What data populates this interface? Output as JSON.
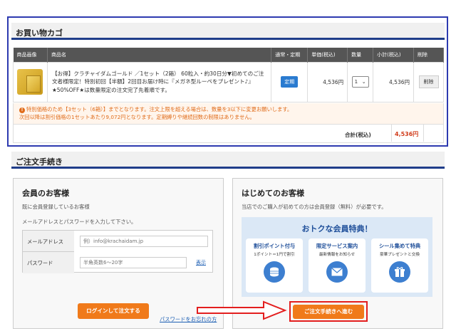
{
  "cart": {
    "section_title": "お買い物カゴ",
    "columns": [
      "商品画像",
      "商品名",
      "通常・定期",
      "単価(税込)",
      "数量",
      "小計(税込)",
      "削除"
    ],
    "item": {
      "name": "【お得】クラチャイダムゴールド ／1セット（2箱） 60粒入・約30日分▼初めてのご注文者様限定！特別初回【半額】2回目お届け時に『メガネ型ルーペをプレゼント♪』★50%OFF★は数量限定の注文完了先着順です。",
      "type_badge": "定期",
      "unit_price": "4,536円",
      "quantity": "1",
      "subtotal": "4,536円",
      "delete_label": "削除"
    },
    "notice_line1": "特別価格のため【3セット（6箱）】までとなります。注文上限を超える場合は、数量を3以下に変更お願いします。",
    "notice_line2": "次回以降は割引価格の1セットあたり9,072円となります。定期縛りや継続回数の制限はありません。",
    "total_label": "合計(税込)",
    "total_value": "4,536円"
  },
  "checkout": {
    "section_title": "ご注文手続き",
    "member": {
      "title": "会員のお客様",
      "desc1": "既に会員登録しているお客様",
      "desc2": "メールアドレスとパスワードを入力して下さい。",
      "email_label": "メールアドレス",
      "email_placeholder": "例）info@krachaidam.jp",
      "password_label": "パスワード",
      "password_placeholder": "半角英数6～20字",
      "show_label": "表示",
      "login_button": "ログインして注文する",
      "forgot_link": "パスワードをお忘れの方"
    },
    "guest": {
      "title": "はじめてのお客様",
      "desc": "当店でのご購入が初めての方は会員登録（無料）が必要です。",
      "benefit_title": "おトクな会員特典！",
      "benefits": [
        {
          "title": "割引ポイント付与",
          "sub": "1ポイント＝1円で割引"
        },
        {
          "title": "限定サービス案内",
          "sub": "最新情報をお知らせ"
        },
        {
          "title": "シール集めて特典",
          "sub": "豪華プレゼントと交換"
        }
      ],
      "proceed_button": "ご注文手続きへ進む"
    }
  },
  "colors": {
    "accent": "#f07a1a",
    "highlight": "#e31e1e",
    "frame": "#2d3ab0",
    "price": "#d13b1a"
  }
}
